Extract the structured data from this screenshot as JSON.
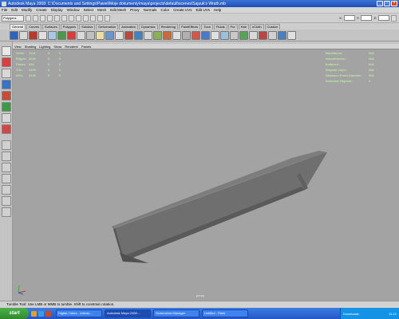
{
  "window": {
    "title": "Autodesk Maya 2008: C:\\Documents and Settings\\Pawel\\Moje dokumenty\\maya\\projects\\default\\scenes\\Sajuuk's Wrath.mb",
    "minimize_icon": "minimize-icon",
    "maximize_icon": "maximize-icon",
    "close_icon": "close-icon"
  },
  "menubar": [
    "File",
    "Edit",
    "Modify",
    "Create",
    "Display",
    "Window",
    "Select",
    "Mesh",
    "Edit Mesh",
    "Proxy",
    "Normals",
    "Color",
    "Create UVs",
    "Edit UVs",
    "Help"
  ],
  "statusline": {
    "mode": "Polygons",
    "x_label": "X:",
    "y_label": "Y:",
    "z_label": "Z:"
  },
  "shelf_tabs": [
    "General",
    "Curves",
    "Surfaces",
    "Polygons",
    "Subdivs",
    "Deformation",
    "Animation",
    "Dynamics",
    "Rendering",
    "PaintEffects",
    "Toon",
    "Fluids",
    "Fur",
    "Hair",
    "nCloth",
    "Custom"
  ],
  "panel_menu": [
    "View",
    "Shading",
    "Lighting",
    "Show",
    "Renderer",
    "Panels"
  ],
  "hud_left": [
    {
      "label": "Verts:",
      "v1": "1114",
      "v2": "0",
      "v3": "0"
    },
    {
      "label": "Edges:",
      "v1": "2040",
      "v2": "0",
      "v3": "0"
    },
    {
      "label": "Faces:",
      "v1": "932",
      "v2": "0",
      "v3": "0"
    },
    {
      "label": "Tris:",
      "v1": "1200",
      "v2": "0",
      "v3": "0"
    },
    {
      "label": "UVs:",
      "v1": "2126",
      "v2": "0",
      "v3": "0"
    }
  ],
  "hud_right": [
    {
      "label": "Backfaces:",
      "value": "N/A"
    },
    {
      "label": "Smoothness:",
      "value": "N/A"
    },
    {
      "label": "Instance:",
      "value": "N/A"
    },
    {
      "label": "Display Layer:",
      "value": "N/A"
    },
    {
      "label": "Distance From Camera:",
      "value": "N/A"
    },
    {
      "label": "Selected Objects:",
      "value": "0"
    }
  ],
  "camera_label": "persp",
  "help_line": "Tumble Tool: Use LMB or MMB to tumble. Shift to constrain rotation.",
  "taskbar": {
    "start": "start",
    "buttons": [
      "Digital-Tutors - Interac...",
      "Autodesk Maya 2008:...",
      "Screenshot Manager",
      "Untitled - Paint"
    ],
    "tray_label": "Downloads",
    "clock": "11:10"
  },
  "colors": {
    "viewport_bg": "#a3a3a3",
    "hud_text": "#bde6a8",
    "titlebar": "#2a5fc8",
    "taskbar": "#2f66d6"
  }
}
